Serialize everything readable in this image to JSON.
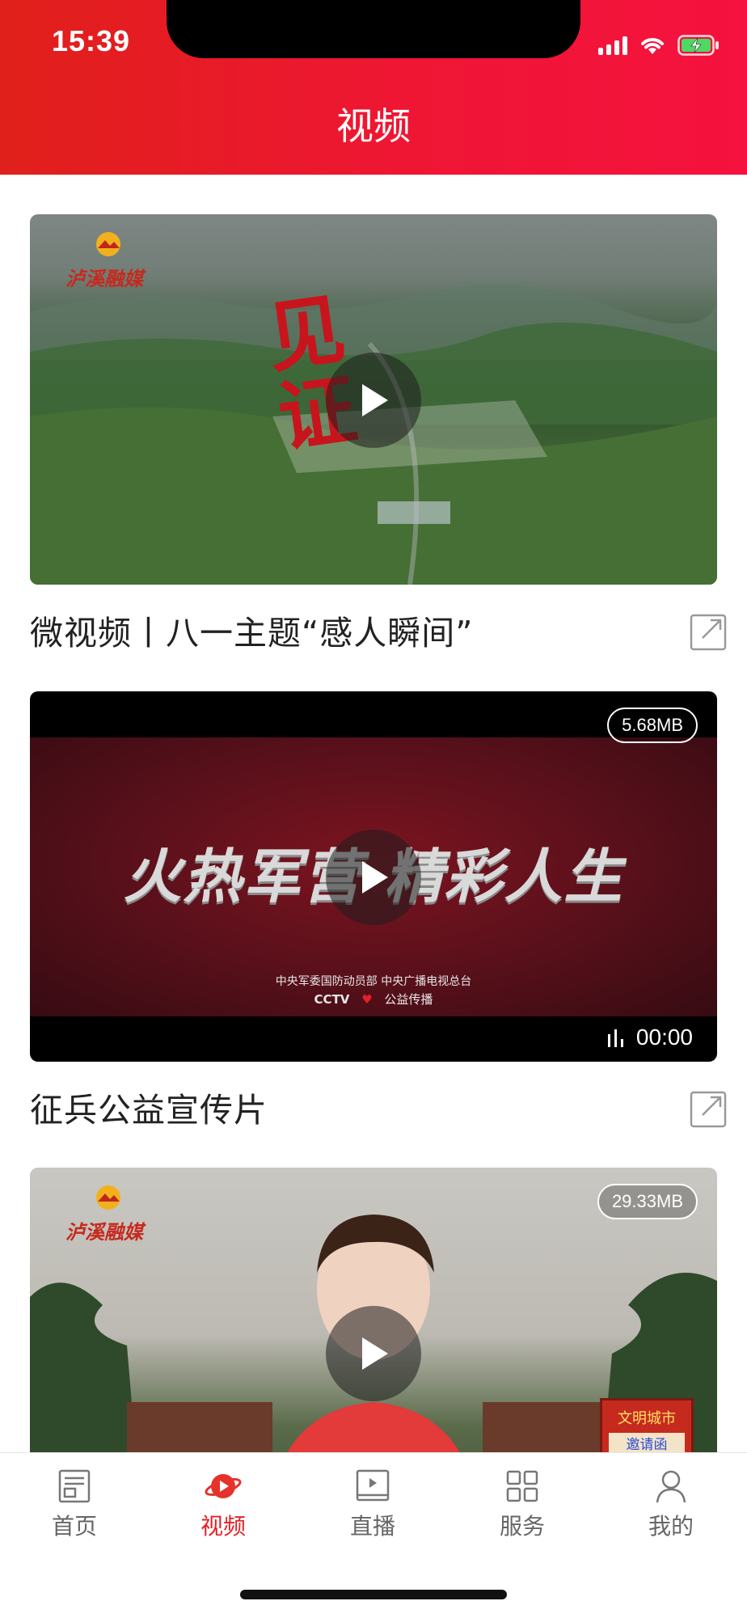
{
  "status_bar": {
    "time": "15:39",
    "icons": [
      "signal-icon",
      "wifi-icon",
      "battery-charging-icon"
    ]
  },
  "header": {
    "title": "视频"
  },
  "colors": {
    "brand_red": "#e51f27",
    "header_gradient_start": "#e0201a",
    "header_gradient_end": "#f5123e",
    "inactive_tab": "#666666"
  },
  "videos": [
    {
      "title": "微视频丨八一主题“感人瞬间”",
      "size": "",
      "duration": "",
      "logo": "泸溪融媒",
      "overlay_text": "见证"
    },
    {
      "title": "征兵公益宣传片",
      "size": "5.68MB",
      "duration": "00:00",
      "overlay_text": "火热军营 精彩人生",
      "credits_line1": "中央军委国防动员部 中央广播电视总台",
      "credits_cctv": "CCTV",
      "credits_line2": "公益传播"
    },
    {
      "title": "",
      "size": "29.33MB",
      "duration": "",
      "logo": "泸溪融媒",
      "sign_line1": "文明城市",
      "sign_line2": "邀请函"
    }
  ],
  "tabbar": {
    "items": [
      {
        "label": "首页",
        "icon": "news-icon",
        "active": false
      },
      {
        "label": "视频",
        "icon": "planet-video-icon",
        "active": true
      },
      {
        "label": "直播",
        "icon": "live-play-icon",
        "active": false
      },
      {
        "label": "服务",
        "icon": "grid-icon",
        "active": false
      },
      {
        "label": "我的",
        "icon": "user-icon",
        "active": false
      }
    ]
  }
}
